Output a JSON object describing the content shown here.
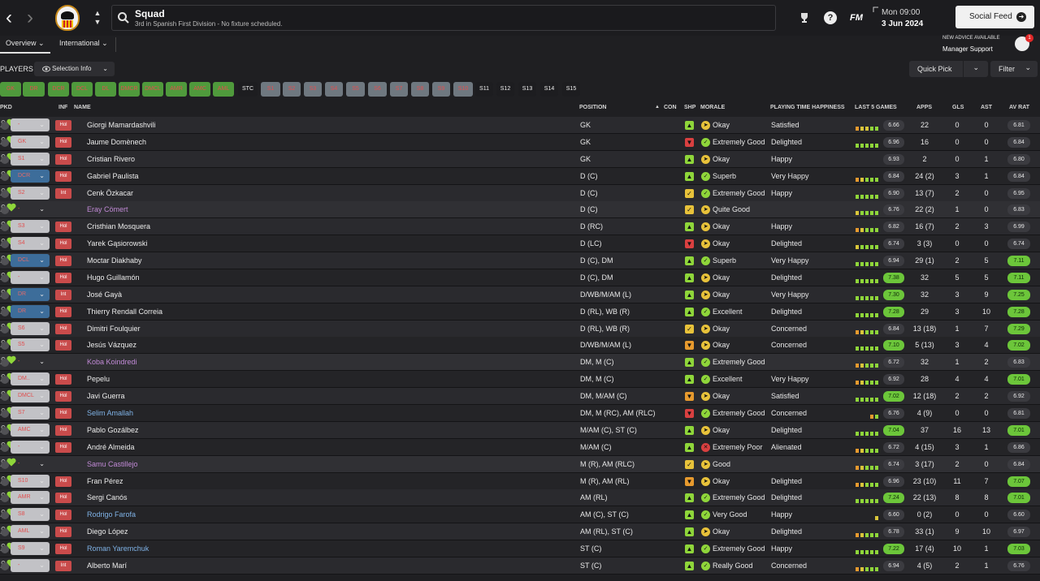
{
  "search": {
    "title": "Squad",
    "subtitle": "3rd in Spanish First Division - No fixture scheduled."
  },
  "topbar": {
    "fm_label": "FM",
    "help_label": "?",
    "date_time": "Mon 09:00",
    "date": "3 Jun 2024",
    "social_feed": "Social Feed"
  },
  "advice": {
    "line1": "NEW ADVICE AVAILABLE",
    "line2": "Manager Support",
    "badge": "1"
  },
  "tabs": [
    {
      "label": "Overview"
    },
    {
      "label": "International"
    }
  ],
  "players_label": "PLAYERS",
  "selection_info": "Selection Info",
  "quick_pick": "Quick Pick",
  "filter": "Filter",
  "positions": [
    {
      "label": "GK",
      "filled": true
    },
    {
      "label": "DR",
      "filled": true
    },
    {
      "label": "DCR",
      "filled": true
    },
    {
      "label": "DCL",
      "filled": true
    },
    {
      "label": "DL",
      "filled": true
    },
    {
      "label": "DMCR",
      "filled": true
    },
    {
      "label": "DMCL",
      "filled": true
    },
    {
      "label": "AMR",
      "filled": true
    },
    {
      "label": "AMC",
      "filled": true
    },
    {
      "label": "AML",
      "filled": true
    },
    {
      "label": "STC",
      "filled": false,
      "dark": true
    },
    {
      "label": "S1",
      "filled": false
    },
    {
      "label": "S2",
      "filled": false
    },
    {
      "label": "S3",
      "filled": false
    },
    {
      "label": "S4",
      "filled": false
    },
    {
      "label": "S5",
      "filled": false
    },
    {
      "label": "S6",
      "filled": false
    },
    {
      "label": "S7",
      "filled": false
    },
    {
      "label": "S8",
      "filled": false
    },
    {
      "label": "S9",
      "filled": false
    },
    {
      "label": "S10",
      "filled": false
    },
    {
      "label": "S11",
      "filled": false,
      "dark": true
    },
    {
      "label": "S12",
      "filled": false,
      "dark": true
    },
    {
      "label": "S13",
      "filled": false,
      "dark": true
    },
    {
      "label": "S14",
      "filled": false,
      "dark": true
    },
    {
      "label": "S15",
      "filled": false,
      "dark": true
    }
  ],
  "headers": {
    "pkd": "PKD",
    "inf": "INF",
    "name": "NAME",
    "position": "POSITION",
    "con": "CON",
    "shp": "SHP",
    "morale": "MORALE",
    "pth": "PLAYING TIME HAPPINESS",
    "last5": "LAST 5 GAMES",
    "apps": "APPS",
    "gls": "GLS",
    "ast": "AST",
    "avrat": "AV RAT"
  },
  "colors": {
    "green": "#8fd63a",
    "yellow": "#e8c23a",
    "orange": "#e79a2e",
    "red": "#d94040",
    "lightgreen": "#b5e55a",
    "loan_name": "#c18ad6",
    "blue_name": "#7fb2e6"
  },
  "players": [
    {
      "pkd": "-",
      "pkd_color": "red",
      "inf": "Hol",
      "name": "Giorgi Mamardashvili",
      "name_color": "white",
      "position": "GK",
      "con": "green",
      "shp": "green",
      "morale": "Okay",
      "morale_color": "yellow",
      "pth": "Satisfied",
      "last5": [
        "o",
        "y",
        "y",
        "g",
        "g"
      ],
      "last_avg": "6.66",
      "last_avg_hl": false,
      "apps": "22",
      "gls": "0",
      "ast": "0",
      "avrat": "6.81",
      "avrat_hl": false
    },
    {
      "pkd": "GK",
      "pkd_color": "red",
      "inf": "Hol",
      "name": "Jaume Domènech",
      "name_color": "white",
      "position": "GK",
      "con": "green",
      "shp": "red",
      "morale": "Extremely Good",
      "morale_color": "green",
      "pth": "Delighted",
      "last5": [
        "g",
        "g",
        "g",
        "g",
        "g"
      ],
      "last_avg": "6.96",
      "last_avg_hl": false,
      "apps": "16",
      "gls": "0",
      "ast": "0",
      "avrat": "6.84",
      "avrat_hl": false
    },
    {
      "pkd": "S1",
      "pkd_color": "red",
      "inf": "Hol",
      "name": "Cristian Rivero",
      "name_color": "white",
      "position": "GK",
      "con": "green",
      "shp": "green",
      "morale": "Okay",
      "morale_color": "yellow",
      "pth": "Happy",
      "last5": [],
      "last_avg": "6.93",
      "last_avg_hl": false,
      "apps": "2",
      "gls": "0",
      "ast": "1",
      "avrat": "6.80",
      "avrat_hl": false
    },
    {
      "pkd": "DCR",
      "pkd_color": "blue",
      "inf": "Hol",
      "name": "Gabriel Paulista",
      "name_color": "white",
      "position": "D (C)",
      "con": "green",
      "shp": "green",
      "morale": "Superb",
      "morale_color": "green",
      "pth": "Very Happy",
      "last5": [
        "o",
        "y",
        "g",
        "g",
        "g"
      ],
      "last_avg": "6.84",
      "last_avg_hl": false,
      "apps": "24 (2)",
      "gls": "3",
      "ast": "1",
      "avrat": "6.84",
      "avrat_hl": false
    },
    {
      "pkd": "S2",
      "pkd_color": "red",
      "inf": "Int",
      "name": "Cenk Özkacar",
      "name_color": "white",
      "position": "D (C)",
      "con": "green",
      "shp": "yellow",
      "morale": "Extremely Good",
      "morale_color": "green",
      "pth": "Happy",
      "last5": [
        "g",
        "g",
        "g",
        "g",
        "g"
      ],
      "last_avg": "6.90",
      "last_avg_hl": false,
      "apps": "13 (7)",
      "gls": "2",
      "ast": "0",
      "avrat": "6.95",
      "avrat_hl": false
    },
    {
      "pkd": "-",
      "pkd_color": "none",
      "inf": "",
      "name": "Eray Cömert",
      "name_color": "loan",
      "position": "D (C)",
      "con": "green",
      "shp": "yellow",
      "morale": "Quite Good",
      "morale_color": "yellow",
      "pth": "",
      "last5": [
        "y",
        "g",
        "g",
        "g",
        "g"
      ],
      "last_avg": "6.76",
      "last_avg_hl": false,
      "apps": "22 (2)",
      "gls": "1",
      "ast": "0",
      "avrat": "6.83",
      "avrat_hl": false
    },
    {
      "pkd": "S3",
      "pkd_color": "red",
      "inf": "Hol",
      "name": "Cristhian Mosquera",
      "name_color": "white",
      "position": "D (RC)",
      "con": "green",
      "shp": "green",
      "morale": "Okay",
      "morale_color": "yellow",
      "pth": "Happy",
      "last5": [
        "o",
        "y",
        "g",
        "g",
        "g"
      ],
      "last_avg": "6.82",
      "last_avg_hl": false,
      "apps": "16 (7)",
      "gls": "2",
      "ast": "3",
      "avrat": "6.99",
      "avrat_hl": false
    },
    {
      "pkd": "S4",
      "pkd_color": "red",
      "inf": "Hol",
      "name": "Yarek Gąsiorowski",
      "name_color": "white",
      "position": "D (LC)",
      "con": "green",
      "shp": "red",
      "morale": "Okay",
      "morale_color": "yellow",
      "pth": "Delighted",
      "last5": [
        "y",
        "g",
        "g",
        "g",
        "g"
      ],
      "last_avg": "6.74",
      "last_avg_hl": false,
      "apps": "3 (3)",
      "gls": "0",
      "ast": "0",
      "avrat": "6.74",
      "avrat_hl": false
    },
    {
      "pkd": "DCL",
      "pkd_color": "blue",
      "inf": "Hol",
      "name": "Moctar Diakhaby",
      "name_color": "white",
      "position": "D (C), DM",
      "con": "green",
      "shp": "green",
      "morale": "Superb",
      "morale_color": "green",
      "pth": "Very Happy",
      "last5": [
        "g",
        "g",
        "g",
        "g",
        "g"
      ],
      "last_avg": "6.94",
      "last_avg_hl": false,
      "apps": "29 (1)",
      "gls": "2",
      "ast": "5",
      "avrat": "7.11",
      "avrat_hl": true
    },
    {
      "pkd": "-",
      "pkd_color": "red",
      "inf": "Hol",
      "name": "Hugo Guillamón",
      "name_color": "white",
      "position": "D (C), DM",
      "con": "green",
      "shp": "green",
      "morale": "Okay",
      "morale_color": "yellow",
      "pth": "Delighted",
      "last5": [
        "g",
        "g",
        "g",
        "g",
        "g"
      ],
      "last_avg": "7.38",
      "last_avg_hl": true,
      "apps": "32",
      "gls": "5",
      "ast": "5",
      "avrat": "7.11",
      "avrat_hl": true
    },
    {
      "pkd": "DR",
      "pkd_color": "blue",
      "inf": "Int",
      "name": "José Gayà",
      "name_color": "white",
      "position": "D/WB/M/AM (L)",
      "con": "green",
      "shp": "green",
      "morale": "Okay",
      "morale_color": "yellow",
      "pth": "Very Happy",
      "last5": [
        "g",
        "g",
        "g",
        "g",
        "g"
      ],
      "last_avg": "7.30",
      "last_avg_hl": true,
      "apps": "32",
      "gls": "3",
      "ast": "9",
      "avrat": "7.25",
      "avrat_hl": true
    },
    {
      "pkd": "DR",
      "pkd_color": "blue",
      "inf": "Hol",
      "name": "Thierry Rendall Correia",
      "name_color": "white",
      "position": "D (RL), WB (R)",
      "con": "green",
      "shp": "green",
      "morale": "Excellent",
      "morale_color": "green",
      "pth": "Delighted",
      "last5": [
        "g",
        "g",
        "g",
        "g",
        "g"
      ],
      "last_avg": "7.28",
      "last_avg_hl": true,
      "apps": "29",
      "gls": "3",
      "ast": "10",
      "avrat": "7.28",
      "avrat_hl": true
    },
    {
      "pkd": "S6",
      "pkd_color": "red",
      "inf": "Hol",
      "name": "Dimitri Foulquier",
      "name_color": "white",
      "position": "D (RL), WB (R)",
      "con": "green",
      "shp": "yellow",
      "morale": "Okay",
      "morale_color": "yellow",
      "pth": "Concerned",
      "last5": [
        "o",
        "y",
        "g",
        "g",
        "g"
      ],
      "last_avg": "6.84",
      "last_avg_hl": false,
      "apps": "13 (18)",
      "gls": "1",
      "ast": "7",
      "avrat": "7.29",
      "avrat_hl": true
    },
    {
      "pkd": "S5",
      "pkd_color": "red",
      "inf": "Hol",
      "name": "Jesús Vázquez",
      "name_color": "white",
      "position": "D/WB/M/AM (L)",
      "con": "green",
      "shp": "orange",
      "morale": "Okay",
      "morale_color": "yellow",
      "pth": "Concerned",
      "last5": [
        "g",
        "g",
        "g",
        "g",
        "g"
      ],
      "last_avg": "7.10",
      "last_avg_hl": true,
      "apps": "5 (13)",
      "gls": "3",
      "ast": "4",
      "avrat": "7.02",
      "avrat_hl": true
    },
    {
      "pkd": "-",
      "pkd_color": "none",
      "inf": "",
      "name": "Koba Koindredi",
      "name_color": "loan",
      "position": "DM, M (C)",
      "con": "green",
      "shp": "green",
      "morale": "Extremely Good",
      "morale_color": "green",
      "pth": "",
      "last5": [
        "o",
        "y",
        "g",
        "g",
        "g"
      ],
      "last_avg": "6.72",
      "last_avg_hl": false,
      "apps": "32",
      "gls": "1",
      "ast": "2",
      "avrat": "6.83",
      "avrat_hl": false
    },
    {
      "pkd": "DM..",
      "pkd_color": "red",
      "inf": "Hol",
      "name": "Pepelu",
      "name_color": "white",
      "position": "DM, M (C)",
      "con": "green",
      "shp": "green",
      "morale": "Excellent",
      "morale_color": "green",
      "pth": "Very Happy",
      "last5": [
        "o",
        "y",
        "g",
        "g",
        "g"
      ],
      "last_avg": "6.92",
      "last_avg_hl": false,
      "apps": "28",
      "gls": "4",
      "ast": "4",
      "avrat": "7.01",
      "avrat_hl": true
    },
    {
      "pkd": "DMCL",
      "pkd_color": "red",
      "inf": "Hol",
      "name": "Javi Guerra",
      "name_color": "white",
      "position": "DM, M/AM (C)",
      "con": "green",
      "shp": "orange",
      "morale": "Okay",
      "morale_color": "yellow",
      "pth": "Satisfied",
      "last5": [
        "g",
        "g",
        "g",
        "g",
        "g"
      ],
      "last_avg": "7.02",
      "last_avg_hl": true,
      "apps": "12 (18)",
      "gls": "2",
      "ast": "2",
      "avrat": "6.92",
      "avrat_hl": false
    },
    {
      "pkd": "S7",
      "pkd_color": "red",
      "inf": "Hol",
      "name": "Selim Amallah",
      "name_color": "blue",
      "position": "DM, M (RC), AM (RLC)",
      "con": "green",
      "shp": "red",
      "morale": "Extremely Good",
      "morale_color": "green",
      "pth": "Concerned",
      "last5": [
        "o",
        "g"
      ],
      "last_avg": "6.76",
      "last_avg_hl": false,
      "apps": "4 (9)",
      "gls": "0",
      "ast": "0",
      "avrat": "6.81",
      "avrat_hl": false
    },
    {
      "pkd": "AMC",
      "pkd_color": "red",
      "inf": "Hol",
      "name": "Pablo Gozálbez",
      "name_color": "white",
      "position": "M/AM (C), ST (C)",
      "con": "green",
      "shp": "green",
      "morale": "Okay",
      "morale_color": "yellow",
      "pth": "Delighted",
      "last5": [
        "g",
        "g",
        "g",
        "g",
        "g"
      ],
      "last_avg": "7.04",
      "last_avg_hl": true,
      "apps": "37",
      "gls": "16",
      "ast": "13",
      "avrat": "7.01",
      "avrat_hl": true
    },
    {
      "pkd": "-",
      "pkd_color": "red",
      "inf": "Hol",
      "name": "André Almeida",
      "name_color": "white",
      "position": "M/AM (C)",
      "con": "green",
      "shp": "green",
      "morale": "Extremely Poor",
      "morale_color": "red",
      "pth": "Alienated",
      "last5": [
        "o",
        "y",
        "g",
        "g",
        "g"
      ],
      "last_avg": "6.72",
      "last_avg_hl": false,
      "apps": "4 (15)",
      "gls": "3",
      "ast": "1",
      "avrat": "6.86",
      "avrat_hl": false
    },
    {
      "pkd": "-",
      "pkd_color": "none",
      "inf": "",
      "name": "Samu Castillejo",
      "name_color": "loan",
      "position": "M (R), AM (RLC)",
      "con": "green",
      "shp": "yellow",
      "morale": "Good",
      "morale_color": "yellow",
      "pth": "",
      "last5": [
        "o",
        "y",
        "g",
        "g",
        "g"
      ],
      "last_avg": "6.74",
      "last_avg_hl": false,
      "apps": "3 (17)",
      "gls": "2",
      "ast": "0",
      "avrat": "6.84",
      "avrat_hl": false
    },
    {
      "pkd": "S10",
      "pkd_color": "red",
      "inf": "Hol",
      "name": "Fran Pérez",
      "name_color": "white",
      "position": "M (R), AM (RL)",
      "con": "green",
      "shp": "orange",
      "morale": "Okay",
      "morale_color": "yellow",
      "pth": "Delighted",
      "last5": [
        "o",
        "y",
        "g",
        "g",
        "g"
      ],
      "last_avg": "6.96",
      "last_avg_hl": false,
      "apps": "23 (10)",
      "gls": "11",
      "ast": "7",
      "avrat": "7.07",
      "avrat_hl": true
    },
    {
      "pkd": "AMR",
      "pkd_color": "red",
      "inf": "Hol",
      "name": "Sergi Canós",
      "name_color": "white",
      "position": "AM (RL)",
      "con": "green",
      "shp": "green",
      "morale": "Extremely Good",
      "morale_color": "green",
      "pth": "Delighted",
      "last5": [
        "g",
        "g",
        "g",
        "g",
        "g"
      ],
      "last_avg": "7.24",
      "last_avg_hl": true,
      "apps": "22 (13)",
      "gls": "8",
      "ast": "8",
      "avrat": "7.01",
      "avrat_hl": true
    },
    {
      "pkd": "S8",
      "pkd_color": "red",
      "inf": "Hol",
      "name": "Rodrigo Farofa",
      "name_color": "blue",
      "position": "AM (C), ST (C)",
      "con": "green",
      "shp": "green",
      "morale": "Very Good",
      "morale_color": "green",
      "pth": "Happy",
      "last5": [
        "y"
      ],
      "last_avg": "6.60",
      "last_avg_hl": false,
      "apps": "0 (2)",
      "gls": "0",
      "ast": "0",
      "avrat": "6.60",
      "avrat_hl": false
    },
    {
      "pkd": "AML",
      "pkd_color": "red",
      "inf": "Hol",
      "name": "Diego López",
      "name_color": "white",
      "position": "AM (RL), ST (C)",
      "con": "green",
      "shp": "green",
      "morale": "Okay",
      "morale_color": "yellow",
      "pth": "Delighted",
      "last5": [
        "o",
        "y",
        "g",
        "g",
        "g"
      ],
      "last_avg": "6.78",
      "last_avg_hl": false,
      "apps": "33 (1)",
      "gls": "9",
      "ast": "10",
      "avrat": "6.97",
      "avrat_hl": false
    },
    {
      "pkd": "S9",
      "pkd_color": "red",
      "inf": "Hol",
      "name": "Roman Yaremchuk",
      "name_color": "blue",
      "position": "ST (C)",
      "con": "green",
      "shp": "green",
      "morale": "Extremely Good",
      "morale_color": "green",
      "pth": "Happy",
      "last5": [
        "g",
        "g",
        "g",
        "g",
        "g"
      ],
      "last_avg": "7.22",
      "last_avg_hl": true,
      "apps": "17 (4)",
      "gls": "10",
      "ast": "1",
      "avrat": "7.03",
      "avrat_hl": true
    },
    {
      "pkd": "-",
      "pkd_color": "red",
      "inf": "Int",
      "name": "Alberto Marí",
      "name_color": "white",
      "position": "ST (C)",
      "con": "green",
      "shp": "green",
      "morale": "Really Good",
      "morale_color": "green",
      "pth": "Concerned",
      "last5": [
        "o",
        "y",
        "g",
        "g",
        "g"
      ],
      "last_avg": "6.94",
      "last_avg_hl": false,
      "apps": "4 (5)",
      "gls": "2",
      "ast": "1",
      "avrat": "6.76",
      "avrat_hl": false
    }
  ]
}
